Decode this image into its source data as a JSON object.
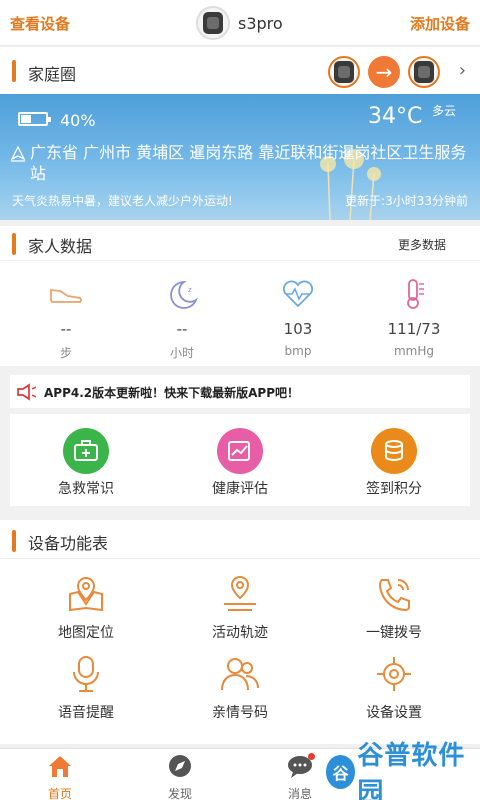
{
  "header": {
    "left_label": "查看设备",
    "device_name": "s3pro",
    "right_label": "添加设备"
  },
  "family": {
    "title": "家庭圈",
    "chevron": "›"
  },
  "weather": {
    "battery_percent": 40,
    "battery_text": "40%",
    "temperature": "34°C",
    "condition": "多云",
    "address": "广东省 广州市 黄埔区 暹岗东路 靠近联和街暹岗社区卫生服务站",
    "tip": "天气炎热易中暑，建议老人减少户外运动!",
    "update": "更新于:3小时33分钟前"
  },
  "family_data": {
    "title": "家人数据",
    "more": "更多数据",
    "metrics": [
      {
        "icon": "shoe-icon",
        "value": "--",
        "unit": "步"
      },
      {
        "icon": "moon-icon",
        "value": "--",
        "unit": "小时"
      },
      {
        "icon": "heart-rate-icon",
        "value": "103",
        "unit": "bmp"
      },
      {
        "icon": "thermometer-icon",
        "value": "111/73",
        "unit": "mmHg"
      }
    ]
  },
  "notice": {
    "text": "APP4.2版本更新啦！快来下载最新版APP吧！"
  },
  "quick_actions": [
    {
      "icon": "first-aid-kit-icon",
      "label": "急救常识",
      "color": "#3bb54a"
    },
    {
      "icon": "health-chart-icon",
      "label": "健康评估",
      "color": "#e75ea6"
    },
    {
      "icon": "coins-icon",
      "label": "签到积分",
      "color": "#e98a1a"
    }
  ],
  "functions": {
    "title": "设备功能表",
    "items": [
      {
        "icon": "map-pin-icon",
        "label": "地图定位"
      },
      {
        "icon": "track-icon",
        "label": "活动轨迹"
      },
      {
        "icon": "phone-icon",
        "label": "一键拨号"
      },
      {
        "icon": "microphone-icon",
        "label": "语音提醒"
      },
      {
        "icon": "contacts-icon",
        "label": "亲情号码"
      },
      {
        "icon": "settings-icon",
        "label": "设备设置"
      }
    ]
  },
  "tabbar": {
    "tabs": [
      {
        "icon": "home-icon",
        "label": "首页",
        "active": true
      },
      {
        "icon": "compass-icon",
        "label": "发现",
        "active": false
      },
      {
        "icon": "message-icon",
        "label": "消息",
        "active": false
      }
    ]
  },
  "watermark": {
    "text": "谷普软件园"
  },
  "colors": {
    "accent": "#e27a1f",
    "sky": "#6eb4e6"
  }
}
